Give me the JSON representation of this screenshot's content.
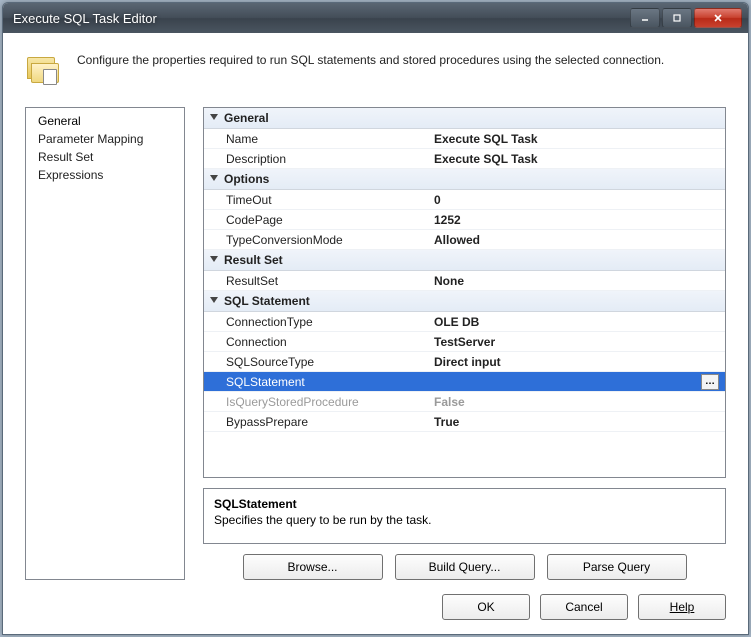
{
  "window": {
    "title": "Execute SQL Task Editor"
  },
  "header": {
    "text": "Configure the properties required to run SQL statements and stored procedures using the selected connection."
  },
  "sidebar": {
    "items": [
      {
        "label": "General"
      },
      {
        "label": "Parameter Mapping"
      },
      {
        "label": "Result Set"
      },
      {
        "label": "Expressions"
      }
    ]
  },
  "propgrid": {
    "groups": [
      {
        "title": "General",
        "rows": [
          {
            "label": "Name",
            "value": "Execute SQL Task"
          },
          {
            "label": "Description",
            "value": "Execute SQL Task"
          }
        ]
      },
      {
        "title": "Options",
        "rows": [
          {
            "label": "TimeOut",
            "value": "0"
          },
          {
            "label": "CodePage",
            "value": "1252"
          },
          {
            "label": "TypeConversionMode",
            "value": "Allowed"
          }
        ]
      },
      {
        "title": "Result Set",
        "rows": [
          {
            "label": "ResultSet",
            "value": "None"
          }
        ]
      },
      {
        "title": "SQL Statement",
        "rows": [
          {
            "label": "ConnectionType",
            "value": "OLE DB"
          },
          {
            "label": "Connection",
            "value": "TestServer"
          },
          {
            "label": "SQLSourceType",
            "value": "Direct input"
          },
          {
            "label": "SQLStatement",
            "value": "",
            "selected": true,
            "hasEllipsis": true
          },
          {
            "label": "IsQueryStoredProcedure",
            "value": "False",
            "disabled": true
          },
          {
            "label": "BypassPrepare",
            "value": "True"
          }
        ]
      }
    ]
  },
  "description": {
    "title": "SQLStatement",
    "body": "Specifies the query to be run by the task."
  },
  "buttons": {
    "browse": "Browse...",
    "build": "Build Query...",
    "parse": "Parse Query",
    "ok": "OK",
    "cancel": "Cancel",
    "help": "Help"
  }
}
